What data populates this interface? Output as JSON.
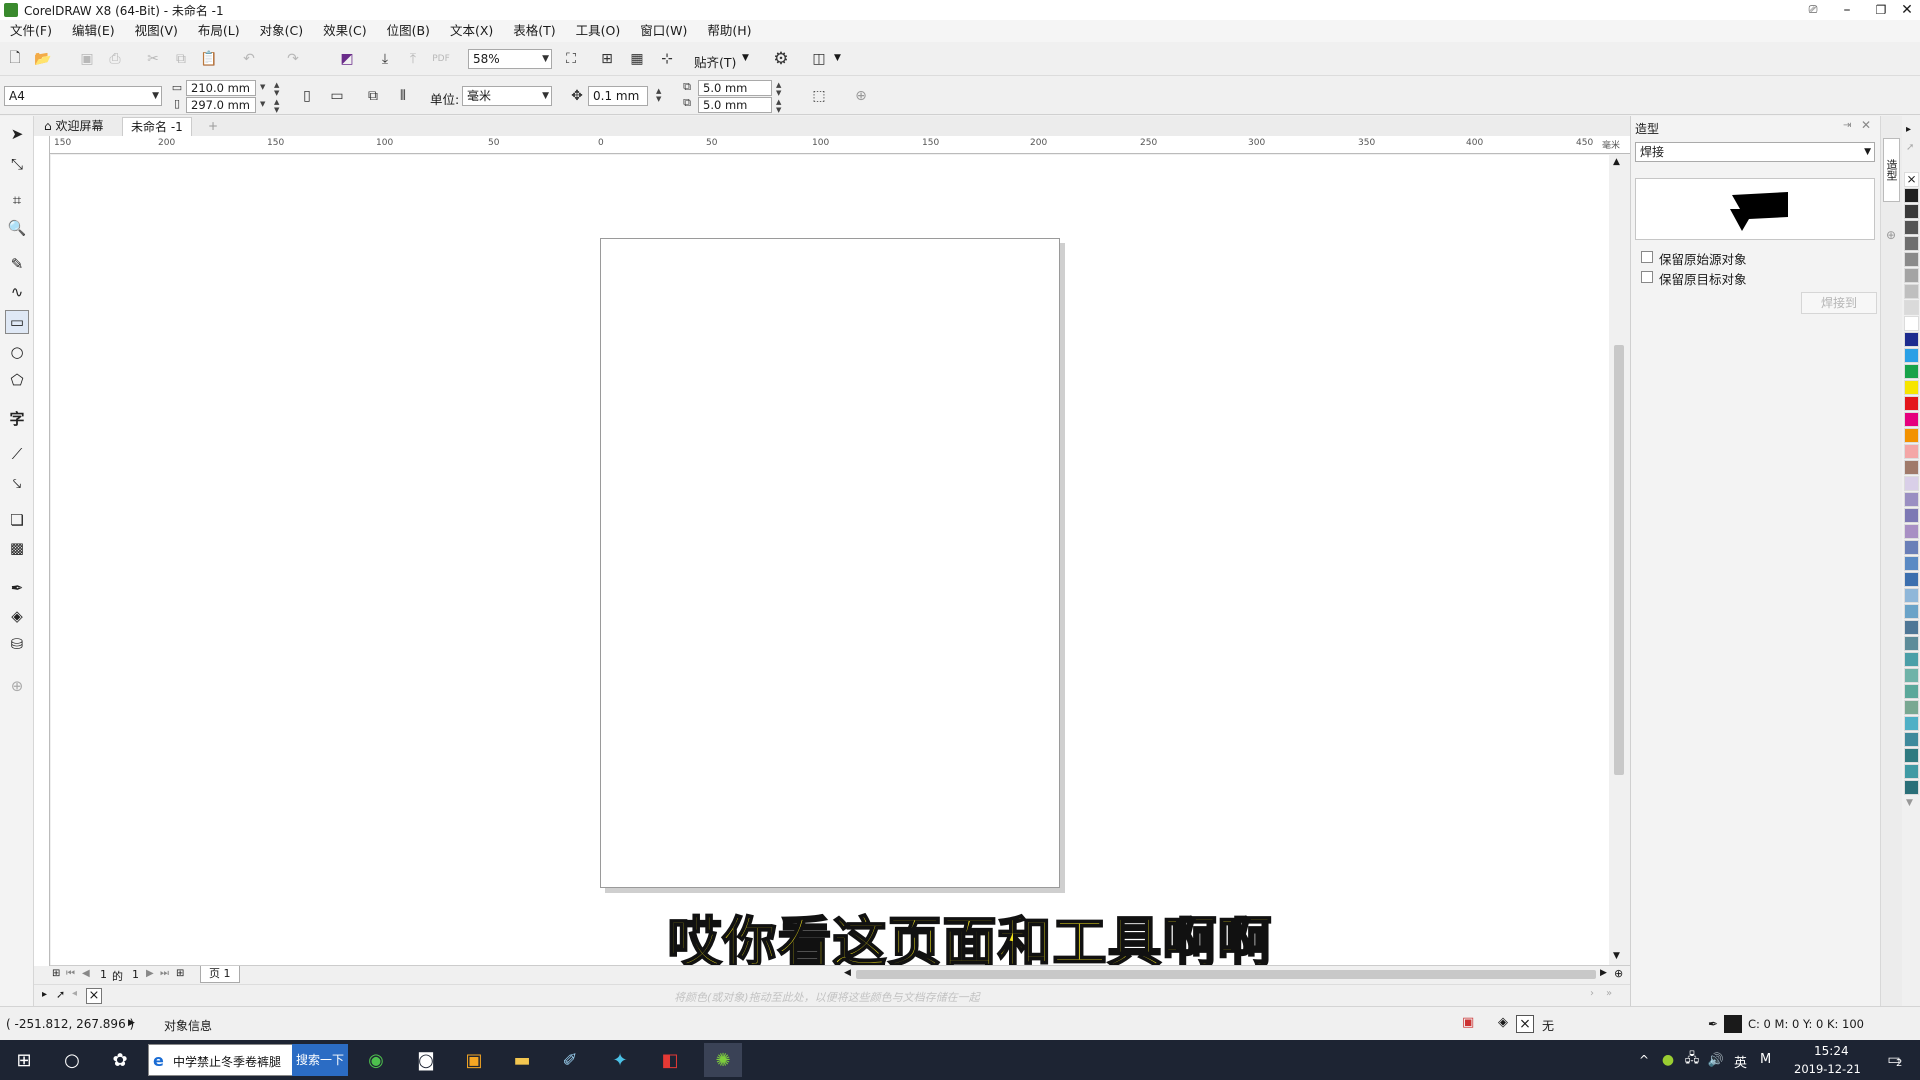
{
  "window": {
    "title": "CorelDRAW X8 (64-Bit) - 未命名 -1"
  },
  "menu": [
    "文件(F)",
    "编辑(E)",
    "视图(V)",
    "布局(L)",
    "对象(C)",
    "效果(C)",
    "位图(B)",
    "文本(X)",
    "表格(T)",
    "工具(O)",
    "窗口(W)",
    "帮助(H)"
  ],
  "toolbar": {
    "zoom": "58%",
    "snap_label": "贴齐(T)"
  },
  "propbar": {
    "page_size": "A4",
    "width": "210.0 mm",
    "height": "297.0 mm",
    "unit_label": "单位:",
    "unit": "毫米",
    "nudge": "0.1 mm",
    "dup_x": "5.0 mm",
    "dup_y": "5.0 mm"
  },
  "tabs": {
    "welcome": "欢迎屏幕",
    "doc": "未命名 -1"
  },
  "ruler": {
    "h_labels": [
      "150",
      "200",
      "150",
      "100",
      "50",
      "0",
      "50",
      "100",
      "150",
      "200",
      "250",
      "300",
      "350",
      "400",
      "450"
    ],
    "unit_label": "毫米"
  },
  "pagenav": {
    "current": "1",
    "of": "的",
    "total": "1",
    "page_tab": "页 1"
  },
  "palette_hint": "将颜色(或对象)拖动至此处，以便将这些颜色与文档存储在一起",
  "subtitle": "哎你看这页面和工具啊啊",
  "docker": {
    "title": "造型",
    "mode": "焊接",
    "keep_source": "保留原始源对象",
    "keep_target": "保留原目标对象",
    "apply": "焊接到",
    "tab_label": "造型"
  },
  "status": {
    "coords": "( -251.812, 267.896 )",
    "info": "对象信息",
    "fill": "无",
    "outline": "C: 0 M: 0 Y: 0 K: 100"
  },
  "taskbar": {
    "browser_text": "中学禁止冬季卷裤腿",
    "search_btn": "搜索一下",
    "ime": "英",
    "ime2": "M",
    "time": "15:24",
    "date": "2019-12-21",
    "notif": "2"
  },
  "colors": {
    "accent": "#2b6cc4",
    "subtitle": "#f5e51b",
    "taskbar": "#1d2433"
  }
}
